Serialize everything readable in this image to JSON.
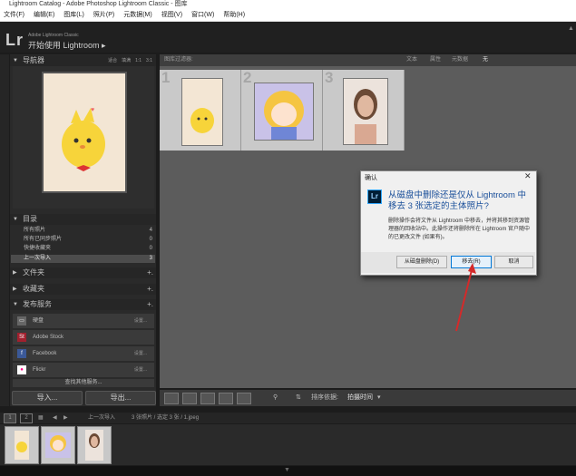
{
  "window": {
    "title": "Lightroom Catalog - Adobe Photoshop Lightroom Classic - 图库"
  },
  "menu": [
    "文件(F)",
    "编辑(E)",
    "图库(L)",
    "照片(P)",
    "元数据(M)",
    "视图(V)",
    "窗口(W)",
    "帮助(H)"
  ],
  "identity": {
    "logo": "Lr",
    "product": "Adobe Lightroom Classic",
    "title": "开始使用 Lightroom"
  },
  "navigator": {
    "label": "导航器",
    "options": [
      "适合",
      "填满",
      "1:1",
      "3:1"
    ]
  },
  "catalog": {
    "label": "目录",
    "rows": [
      {
        "name": "所有照片",
        "count": "4"
      },
      {
        "name": "所有已同步照片",
        "count": "0"
      },
      {
        "name": "快捷收藏夹",
        "count": "0"
      },
      {
        "name": "上一次导入",
        "count": "3"
      }
    ]
  },
  "folders": {
    "label": "文件夹"
  },
  "collections": {
    "label": "收藏夹"
  },
  "publish": {
    "label": "发布服务",
    "services": [
      {
        "name": "硬盘",
        "icon": "hard-drive-icon",
        "right": "设置..."
      },
      {
        "name": "Adobe Stock",
        "icon": "adobe-stock-icon",
        "right": ""
      },
      {
        "name": "Facebook",
        "icon": "facebook-icon",
        "right": "设置..."
      },
      {
        "name": "Flickr",
        "icon": "flickr-icon",
        "right": "设置..."
      }
    ],
    "more": "查找其他服务..."
  },
  "buttons": {
    "import": "导入...",
    "export": "导出..."
  },
  "gridbar": {
    "label": "图库过滤器:",
    "filters": [
      "文本",
      "属性",
      "元数据",
      "无"
    ]
  },
  "grid": {
    "cells": [
      {
        "num": "1"
      },
      {
        "num": "2"
      },
      {
        "num": "3"
      }
    ]
  },
  "toolbar": {
    "sort_label": "排序依据:",
    "sort_value": "拍摄时间"
  },
  "filmstrip": {
    "pages": [
      "1",
      "2"
    ],
    "path": "上一次导入",
    "info": "3 张照片 / 选定 3 张 / 1.jpeg"
  },
  "dialog": {
    "title": "确认",
    "heading": "从磁盘中删除还是仅从 Lightroom 中移去 3 张选定的主体照片?",
    "body": "删除操作会将文件从 Lightroom 中移去，并将其移到资源管理器的回收站中。此操作还将删除所在 Lightroom 官户随中的已更改文件 (如果有)。",
    "buttons": {
      "delete": "从磁盘删除(D)",
      "remove": "移去(R)",
      "cancel": "取消"
    }
  },
  "colors": {
    "accent_red": "#d42a2a",
    "dialog_heading": "#1a4f9a",
    "grid_bg": "#5c5c5c"
  }
}
